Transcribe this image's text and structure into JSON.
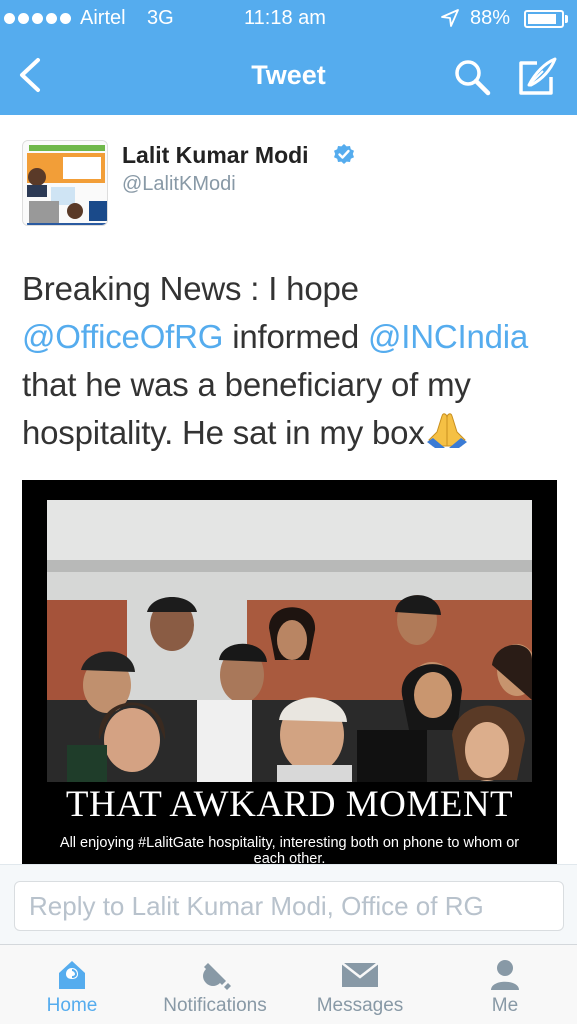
{
  "status_bar": {
    "carrier": "Airtel",
    "network": "3G",
    "time": "11:18 am",
    "battery": "88%",
    "battery_level": 0.88
  },
  "nav": {
    "title": "Tweet",
    "back_icon": "chevron-left-icon",
    "search_icon": "search-icon",
    "compose_icon": "compose-icon"
  },
  "tweet": {
    "author_name": "Lalit Kumar Modi",
    "author_handle": "@LalitKModi",
    "text_part1": "Breaking News : I hope ",
    "mention1": "@OfficeOfRG",
    "text_part2": " informed ",
    "mention2": "@INCIndia",
    "text_part3": " that he was a beneficiary of my hospitality. He sat in my  box",
    "emoji": "folded-hands-icon"
  },
  "media": {
    "caption_title": "THAT AWKARD MOMENT",
    "caption_sub": "All enjoying #LalitGate hospitality, interesting both on phone to whom or each other."
  },
  "reply": {
    "placeholder": "Reply to Lalit Kumar Modi, Office of RG"
  },
  "tabs": [
    {
      "label": "Home",
      "icon": "home-icon",
      "active": true
    },
    {
      "label": "Notifications",
      "icon": "bell-icon",
      "active": false
    },
    {
      "label": "Messages",
      "icon": "envelope-icon",
      "active": false
    },
    {
      "label": "Me",
      "icon": "person-icon",
      "active": false
    }
  ],
  "colors": {
    "accent": "#55acee",
    "muted": "#8899a6"
  }
}
